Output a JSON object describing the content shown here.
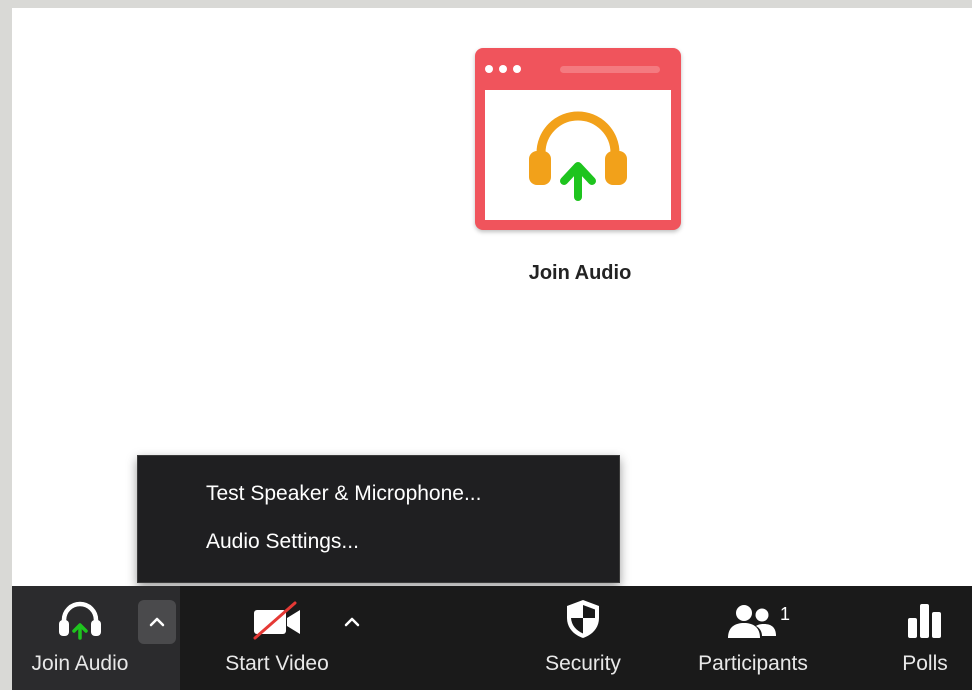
{
  "main": {
    "join_audio_label": "Join Audio"
  },
  "audio_menu": {
    "items": [
      {
        "label": "Test Speaker & Microphone..."
      },
      {
        "label": "Audio Settings..."
      }
    ]
  },
  "toolbar": {
    "join_audio": "Join Audio",
    "start_video": "Start Video",
    "security": "Security",
    "participants": "Participants",
    "participants_count": "1",
    "polls": "Polls"
  },
  "colors": {
    "card_red": "#f0545c",
    "headphone_orange": "#f2a11a",
    "arrow_green": "#1ec41e",
    "toolbar_bg": "#1a1a1a"
  }
}
